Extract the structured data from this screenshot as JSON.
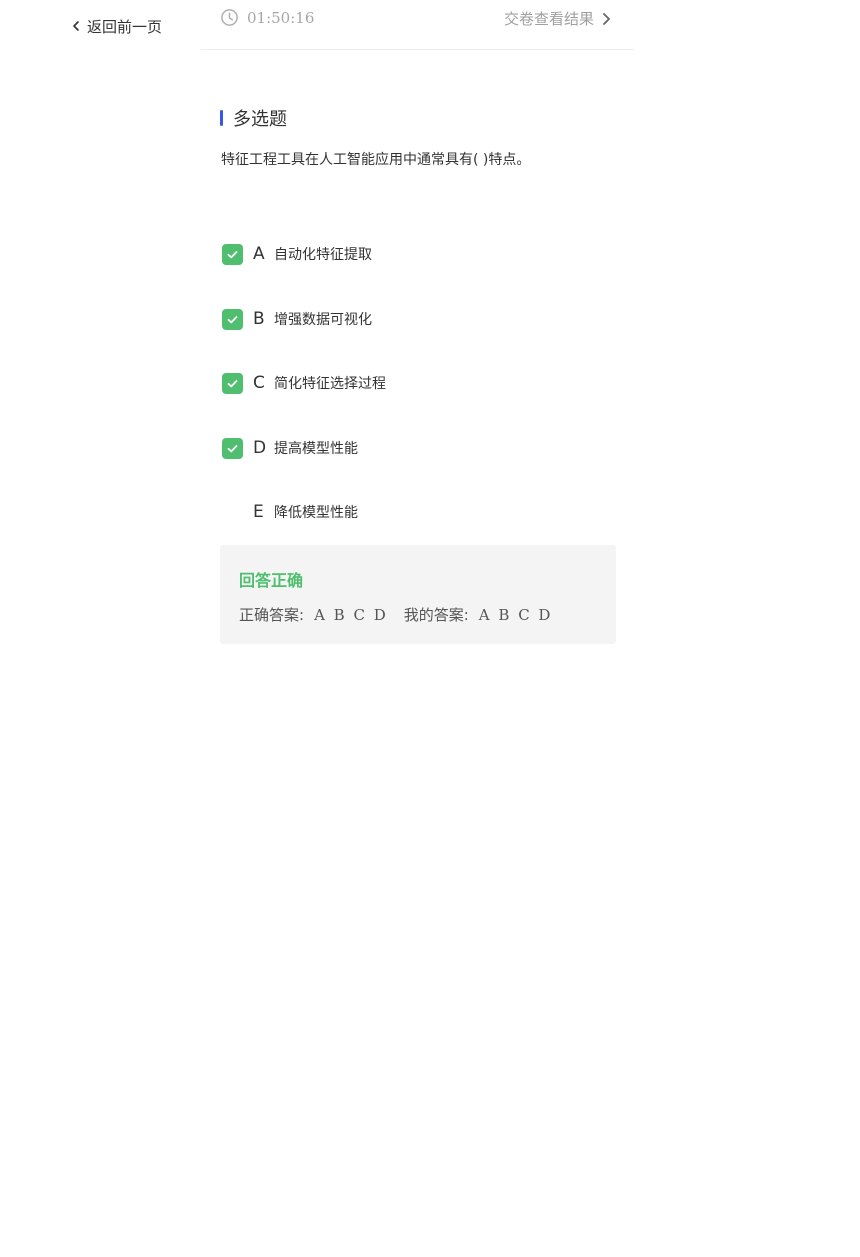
{
  "nav": {
    "back_label": "返回前一页"
  },
  "header": {
    "timer": "01:50:16",
    "submit_label": "交卷查看结果"
  },
  "question": {
    "type": "多选题",
    "text": "特征工程工具在人工智能应用中通常具有(  )特点。",
    "options": [
      {
        "letter": "A",
        "text": "自动化特征提取",
        "checked": true
      },
      {
        "letter": "B",
        "text": "增强数据可视化",
        "checked": true
      },
      {
        "letter": "C",
        "text": "简化特征选择过程",
        "checked": true
      },
      {
        "letter": "D",
        "text": "提高模型性能",
        "checked": true
      },
      {
        "letter": "E",
        "text": "降低模型性能",
        "checked": false
      }
    ]
  },
  "result": {
    "status": "回答正确",
    "correct_label": "正确答案:",
    "correct_value": "A B C D",
    "my_label": "我的答案:",
    "my_value": "A B C D"
  },
  "colors": {
    "accent_blue": "#3558e6",
    "check_green": "#4fbf6f",
    "muted_gray": "#a6a6a6",
    "card_bg": "#f4f4f4"
  }
}
